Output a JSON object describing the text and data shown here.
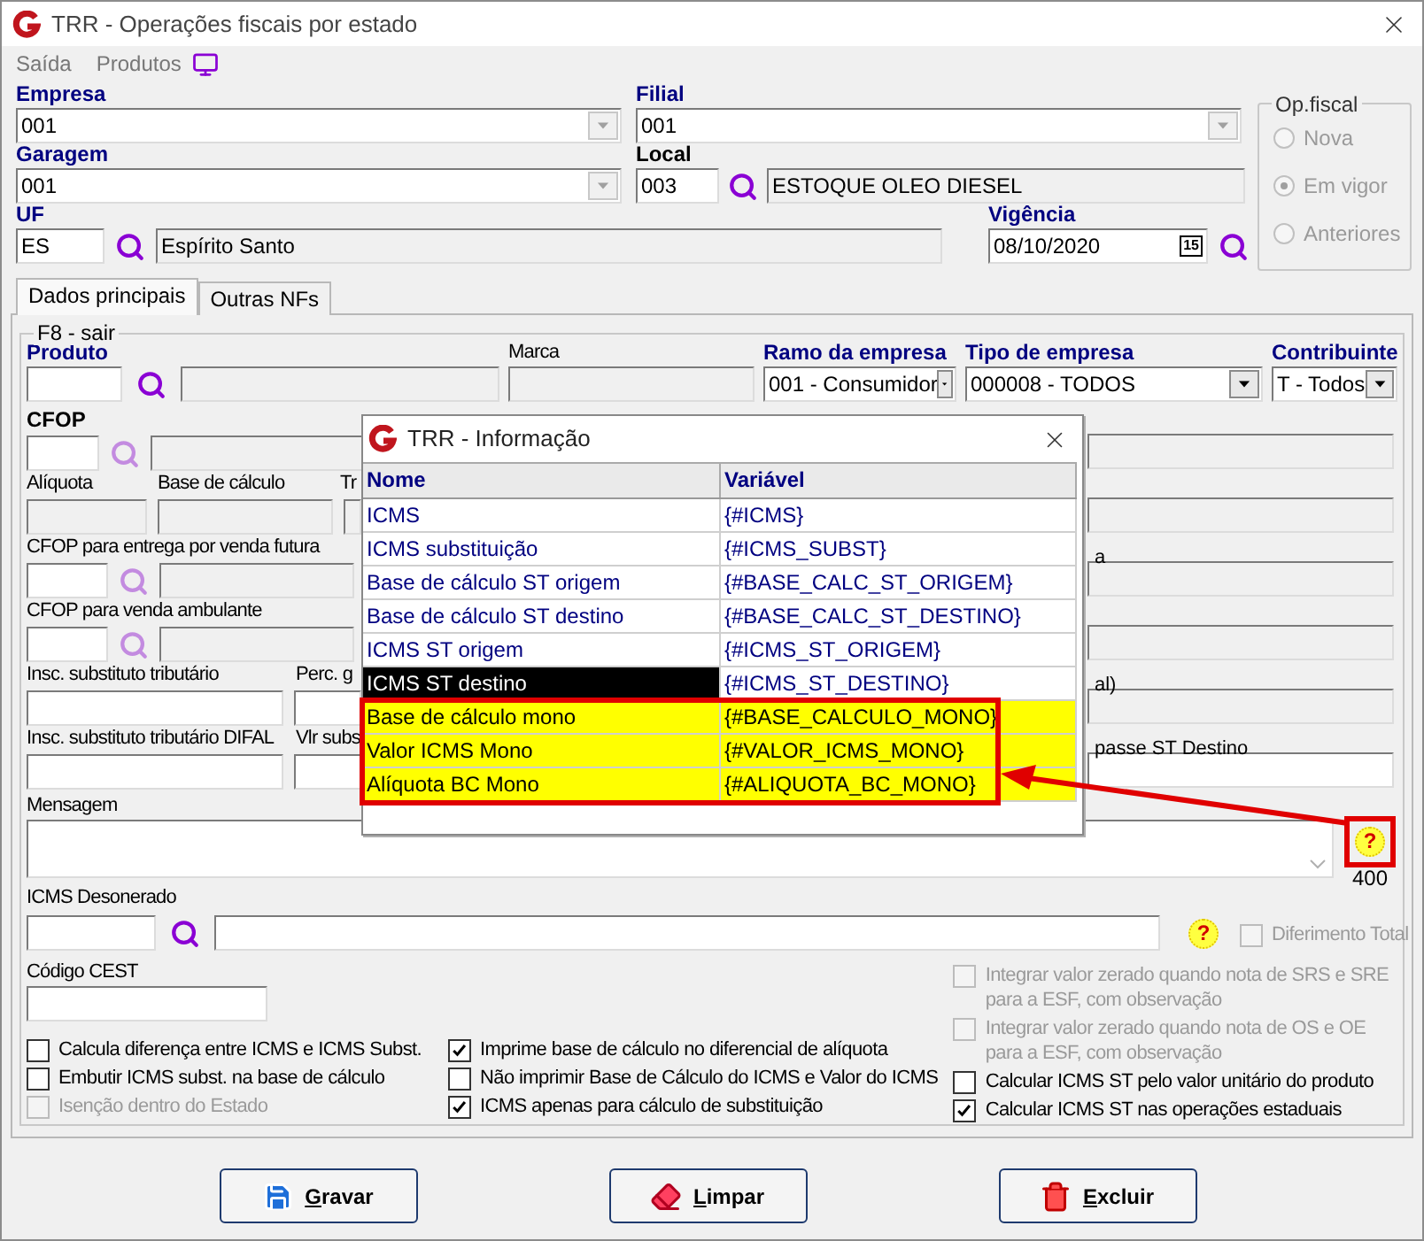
{
  "window": {
    "title": "TRR - Operações fiscais por estado"
  },
  "menu": [
    "Saída",
    "Produtos"
  ],
  "header": {
    "empresa": {
      "label": "Empresa",
      "value": "001"
    },
    "filial": {
      "label": "Filial",
      "value": "001"
    },
    "garagem": {
      "label": "Garagem",
      "value": "001"
    },
    "local": {
      "label": "Local",
      "code": "003",
      "description": "ESTOQUE OLEO DIESEL"
    },
    "uf": {
      "label": "UF",
      "code": "ES",
      "description": "Espírito Santo"
    },
    "vigencia": {
      "label": "Vigência",
      "value": "08/10/2020",
      "calendar_badge": "15"
    }
  },
  "op_fiscal": {
    "title": "Op.fiscal",
    "options": [
      {
        "label": "Nova",
        "selected": false
      },
      {
        "label": "Em vigor",
        "selected": true
      },
      {
        "label": "Anteriores",
        "selected": false
      }
    ]
  },
  "tabs": [
    {
      "label": "Dados principais",
      "selected": true
    },
    {
      "label": "Outras NFs",
      "selected": false
    }
  ],
  "group_title": "F8 - sair",
  "form": {
    "produto": "Produto",
    "marca": "Marca",
    "ramo": {
      "label": "Ramo da empresa",
      "value": "001 - Consumidor"
    },
    "tipo": {
      "label": "Tipo de empresa",
      "value": "000008 - TODOS"
    },
    "contribuinte": {
      "label": "Contribuinte",
      "value": "T - Todos"
    },
    "cfop": "CFOP",
    "aliquota": "Alíquota",
    "base": "Base de cálculo",
    "column_3": "Tr",
    "cfop_futura": "CFOP para entrega por venda futura",
    "right_label_1": "a",
    "cfop_ambulante": "CFOP para venda ambulante",
    "insc": "Insc. substituto tributário",
    "perc": "Perc. g",
    "right_label_2": "al)",
    "insc_difal": "Insc. substituto tributário DIFAL",
    "vlr": "Vlr subs",
    "right_label_3": "passe ST Destino",
    "mensagem": "Mensagem",
    "mensagem_help": "?",
    "mensagem_counter": "400",
    "desonerado": "ICMS Desonerado",
    "desonerado_help": "?",
    "diferimento": {
      "label": "Diferimento Total",
      "checked": false,
      "disabled": true
    },
    "cest": "Código CEST"
  },
  "checks_left": [
    {
      "label": "Calcula diferença entre ICMS e ICMS Subst.",
      "checked": false,
      "disabled": false
    },
    {
      "label": "Embutir ICMS subst. na base de cálculo",
      "checked": false,
      "disabled": false
    },
    {
      "label": "Isenção dentro do Estado",
      "checked": false,
      "disabled": true
    }
  ],
  "checks_middle": [
    {
      "label": "Imprime base de cálculo no diferencial de alíquota",
      "checked": true,
      "disabled": false
    },
    {
      "label": "Não imprimir Base de Cálculo do ICMS e Valor do ICMS",
      "checked": false,
      "disabled": false
    },
    {
      "label": "ICMS apenas para cálculo de substituição",
      "checked": true,
      "disabled": false
    }
  ],
  "checks_right": [
    {
      "label": "Integrar valor zerado quando nota de SRS e SRE para a ESF, com observação",
      "checked": false,
      "disabled": true
    },
    {
      "label": "Integrar valor zerado quando nota de OS e OE para a ESF, com observação",
      "checked": false,
      "disabled": true
    },
    {
      "label": "Calcular ICMS ST pelo valor unitário do produto",
      "checked": false,
      "disabled": false
    },
    {
      "label": "Calcular ICMS ST nas operações estaduais",
      "checked": true,
      "disabled": false
    }
  ],
  "buttons": [
    {
      "label": "Gravar",
      "kind": "save"
    },
    {
      "label": "Limpar",
      "kind": "clear"
    },
    {
      "label": "Excluir",
      "kind": "delete"
    }
  ],
  "dialog": {
    "title": "TRR - Informação",
    "columns": [
      "Nome",
      "Variável"
    ],
    "rows": [
      {
        "name": "ICMS",
        "variable": "{#ICMS}",
        "selected": false,
        "highlighted": false
      },
      {
        "name": "ICMS substituição",
        "variable": "{#ICMS_SUBST}",
        "selected": false,
        "highlighted": false
      },
      {
        "name": "Base de cálculo ST origem",
        "variable": "{#BASE_CALC_ST_ORIGEM}",
        "selected": false,
        "highlighted": false
      },
      {
        "name": "Base de cálculo ST destino",
        "variable": "{#BASE_CALC_ST_DESTINO}",
        "selected": false,
        "highlighted": false
      },
      {
        "name": "ICMS ST origem",
        "variable": "{#ICMS_ST_ORIGEM}",
        "selected": false,
        "highlighted": false
      },
      {
        "name": "ICMS ST destino",
        "variable": "{#ICMS_ST_DESTINO}",
        "selected": true,
        "highlighted": false
      },
      {
        "name": "Base de cálculo mono",
        "variable": "{#BASE_CALCULO_MONO}",
        "selected": false,
        "highlighted": true
      },
      {
        "name": "Valor ICMS Mono",
        "variable": "{#VALOR_ICMS_MONO}",
        "selected": false,
        "highlighted": true
      },
      {
        "name": "Alíquota BC Mono",
        "variable": "{#ALIQUOTA_BC_MONO}",
        "selected": false,
        "highlighted": true
      }
    ]
  }
}
